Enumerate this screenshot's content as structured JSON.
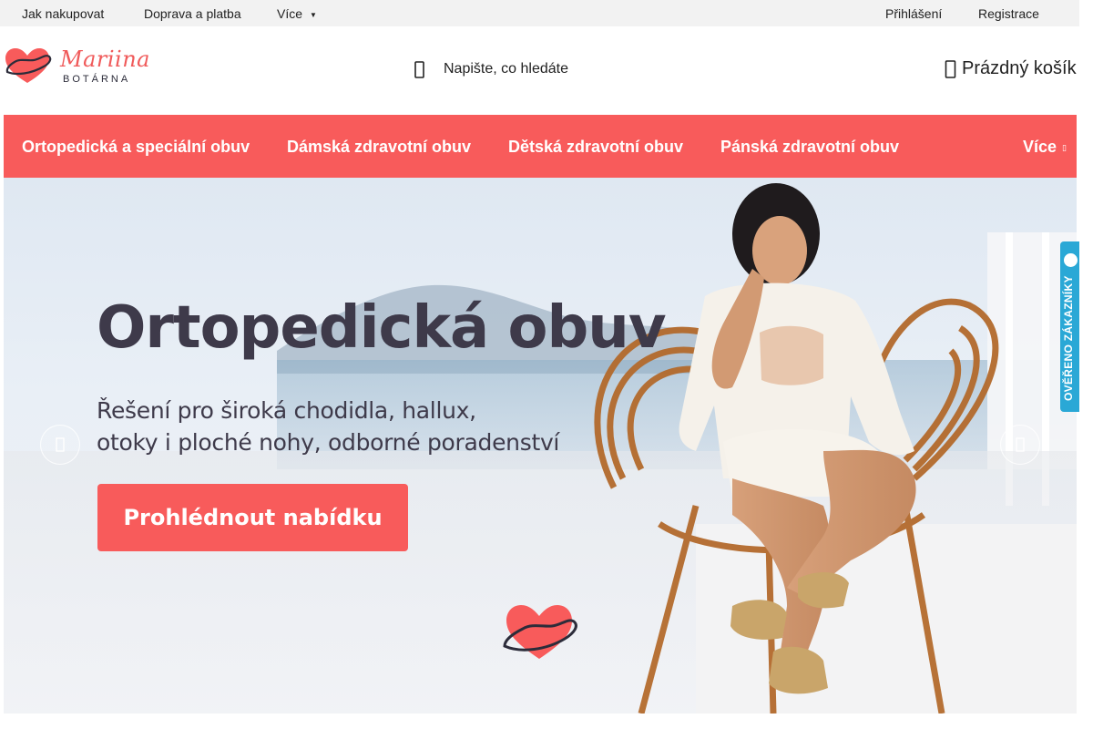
{
  "topbar": {
    "how_to_buy": "Jak nakupovat",
    "shipping_payment": "Doprava a platba",
    "more": "Více",
    "login": "Přihlášení",
    "register": "Registrace"
  },
  "logo": {
    "name": "Mariina",
    "subtitle": "BOTÁRNA",
    "brand_color": "#f05a5a"
  },
  "search": {
    "placeholder": "Napište, co hledáte",
    "icon": "search-icon"
  },
  "cart": {
    "label": "Prázdný košík",
    "icon": "cart-icon"
  },
  "nav": {
    "items": [
      {
        "label": "Ortopedická a speciální obuv"
      },
      {
        "label": "Dámská zdravotní obuv"
      },
      {
        "label": "Dětská zdravotní obuv"
      },
      {
        "label": "Pánská zdravotní obuv"
      }
    ],
    "more": "Více",
    "background": "#f85b5b"
  },
  "hero": {
    "title": "Ortopedická obuv",
    "subtitle_lines": [
      "Řešení pro široká chodidla, hallux,",
      "otoky i ploché nohy, odborné poradenství"
    ],
    "cta": "Prohlédnout nabídku",
    "cta_color": "#f85b5b"
  },
  "badge": {
    "text": "OVĚŘENO ZÁKAZNÍKY",
    "color": "#2aa8d6"
  }
}
